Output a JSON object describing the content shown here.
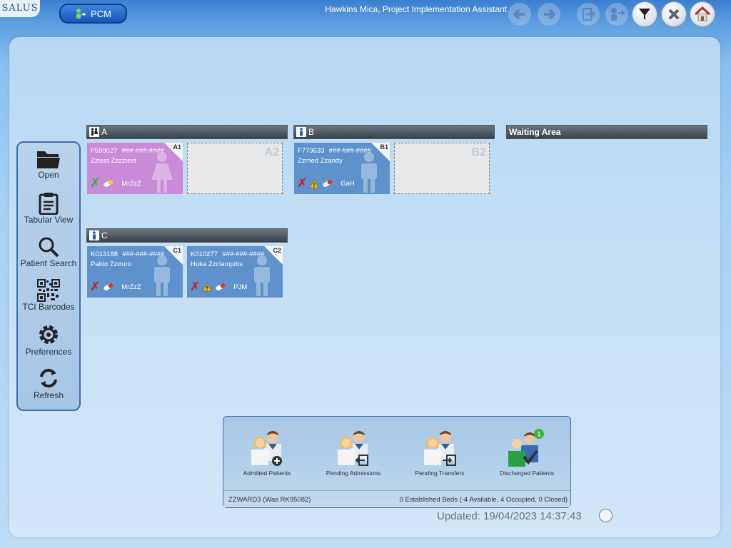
{
  "app": {
    "logo_text": "SALUS",
    "module_label": "PCM"
  },
  "user": {
    "title": "Hawkins Mica, Project Implementation Assistant"
  },
  "toolbar": {
    "icons": [
      "back-arrow-icon",
      "forward-arrow-icon",
      "exit-icon",
      "transfer-icon",
      "filter-icon",
      "close-icon",
      "home-icon"
    ]
  },
  "nav": {
    "open": "Open",
    "tabular": "Tabular View",
    "search": "Patient Search",
    "tci": "TCI Barcodes",
    "prefs": "Preferences",
    "refresh": "Refresh"
  },
  "rooms": {
    "a": {
      "label": "A"
    },
    "b": {
      "label": "B"
    },
    "c": {
      "label": "C"
    },
    "waiting": {
      "label": "Waiting Area"
    }
  },
  "beds": {
    "a1": {
      "code": "A1",
      "id": "F599027",
      "mask": "###-###-####",
      "name": "Zztest Zzzztest",
      "consultant": "MrZzZ",
      "gender": "female"
    },
    "a2": {
      "code": "A2"
    },
    "b1": {
      "code": "B1",
      "id": "F773633",
      "mask": "###-###-####",
      "name": "Zzmed Zzandy",
      "consultant": "GaH",
      "gender": "male"
    },
    "b2": {
      "code": "B2"
    },
    "c1": {
      "code": "C1",
      "id": "K013188",
      "mask": "###-###-####",
      "name": "Pablo Zztruro",
      "consultant": "MrZzZ",
      "gender": "male"
    },
    "c2": {
      "code": "C2",
      "id": "K010277",
      "mask": "###-###-####",
      "name": "Hoka Zzclampitts",
      "consultant": "PJM",
      "gender": "male"
    }
  },
  "summary": {
    "admitted": "Admitted Patients",
    "pending_admissions": "Pending Admissions",
    "pending_transfers": "Pending Transfers",
    "discharged": "Discharged Patients",
    "discharged_count": "1",
    "ward": "ZZWARD3 (Was RK95082)",
    "beds": "0 Established Beds (-4 Available, 4 Occupied, 0 Closed)"
  },
  "status": {
    "updated": "Updated: 19/04/2023 14:37:43"
  },
  "colors": {
    "female_bed": "#c98ad8",
    "male_bed": "#5f92cc",
    "accent": "#1655b8"
  }
}
